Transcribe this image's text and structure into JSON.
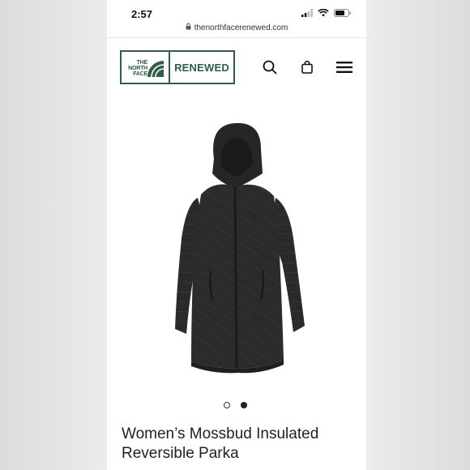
{
  "status_bar": {
    "time": "2:57"
  },
  "browser": {
    "url": "thenorthfacerenewed.com"
  },
  "header": {
    "logo_brand_lines": [
      "THE",
      "NORTH",
      "FACE"
    ],
    "logo_word": "RENEWED",
    "icons": [
      "search-icon",
      "shopping-bag-icon",
      "hamburger-menu-icon"
    ]
  },
  "product": {
    "title": "Women’s Mossbud Insulated Reversible Parka",
    "image_count": 2,
    "active_image": 2
  },
  "colors": {
    "brand_green": "#2e5e45",
    "text": "#222222"
  }
}
